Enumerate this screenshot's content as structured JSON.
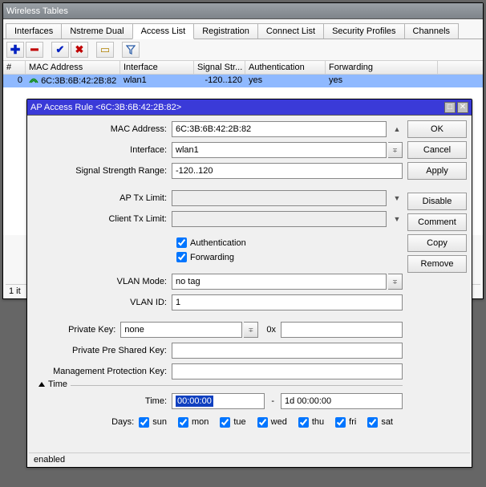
{
  "main_window": {
    "title": "Wireless Tables",
    "tabs": [
      "Interfaces",
      "Nstreme Dual",
      "Access List",
      "Registration",
      "Connect List",
      "Security Profiles",
      "Channels"
    ],
    "active_tab": 2,
    "table": {
      "headers": [
        "#",
        "MAC Address",
        "Interface",
        "Signal Str...",
        "Authentication",
        "Forwarding"
      ],
      "rows": [
        {
          "num": "0",
          "mac": "6C:3B:6B:42:2B:82",
          "iface": "wlan1",
          "signal": "-120..120",
          "auth": "yes",
          "fwd": "yes"
        }
      ]
    },
    "status_count": "1 it"
  },
  "toolbar_icons": {
    "add": "+",
    "remove": "−",
    "check": "✓",
    "x": "✖",
    "note": "▭",
    "filter": "▾"
  },
  "dialog": {
    "title": "AP Access Rule <6C:3B:6B:42:2B:82>",
    "buttons": [
      "OK",
      "Cancel",
      "Apply",
      "Disable",
      "Comment",
      "Copy",
      "Remove"
    ],
    "fields": {
      "mac_address_label": "MAC Address:",
      "mac_address": "6C:3B:6B:42:2B:82",
      "interface_label": "Interface:",
      "interface": "wlan1",
      "signal_range_label": "Signal Strength Range:",
      "signal_range": "-120..120",
      "ap_tx_label": "AP Tx Limit:",
      "ap_tx": "",
      "client_tx_label": "Client Tx Limit:",
      "client_tx": "",
      "authentication_label": "Authentication",
      "forwarding_label": "Forwarding",
      "vlan_mode_label": "VLAN Mode:",
      "vlan_mode": "no tag",
      "vlan_id_label": "VLAN ID:",
      "vlan_id": "1",
      "private_key_label": "Private Key:",
      "private_key": "none",
      "private_key_hex_label": "0x",
      "private_key_hex": "",
      "psk_label": "Private Pre Shared Key:",
      "psk": "",
      "mpk_label": "Management Protection Key:",
      "mpk": "",
      "time_section": "Time",
      "time_label": "Time:",
      "time_from": "00:00:00",
      "time_sep": "-",
      "time_to": "1d 00:00:00",
      "days_label": "Days:",
      "days": [
        "sun",
        "mon",
        "tue",
        "wed",
        "thu",
        "fri",
        "sat"
      ]
    },
    "status": "enabled"
  }
}
